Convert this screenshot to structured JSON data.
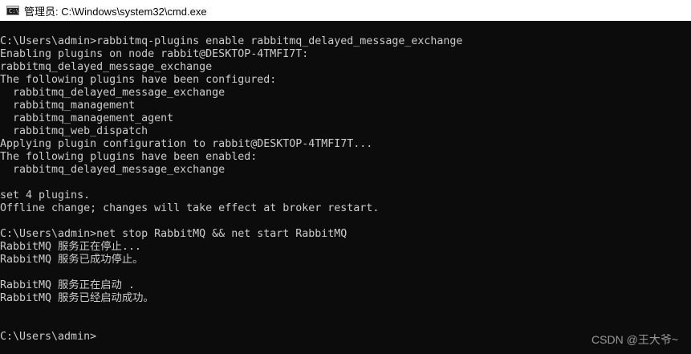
{
  "window": {
    "icon_text": "C:\\",
    "title": "管理员: C:\\Windows\\system32\\cmd.exe"
  },
  "terminal": {
    "lines": [
      "C:\\Users\\admin>rabbitmq-plugins enable rabbitmq_delayed_message_exchange",
      "Enabling plugins on node rabbit@DESKTOP-4TMFI7T:",
      "rabbitmq_delayed_message_exchange",
      "The following plugins have been configured:",
      "  rabbitmq_delayed_message_exchange",
      "  rabbitmq_management",
      "  rabbitmq_management_agent",
      "  rabbitmq_web_dispatch",
      "Applying plugin configuration to rabbit@DESKTOP-4TMFI7T...",
      "The following plugins have been enabled:",
      "  rabbitmq_delayed_message_exchange",
      "",
      "set 4 plugins.",
      "Offline change; changes will take effect at broker restart.",
      "",
      "C:\\Users\\admin>net stop RabbitMQ && net start RabbitMQ",
      "RabbitMQ 服务正在停止...",
      "RabbitMQ 服务已成功停止。",
      "",
      "RabbitMQ 服务正在启动 .",
      "RabbitMQ 服务已经启动成功。",
      "",
      "",
      "C:\\Users\\admin>"
    ]
  },
  "watermark": "CSDN @王大爷~",
  "colors": {
    "background": "#0c0c0c",
    "text": "#cccccc",
    "titlebar": "#ffffff"
  }
}
